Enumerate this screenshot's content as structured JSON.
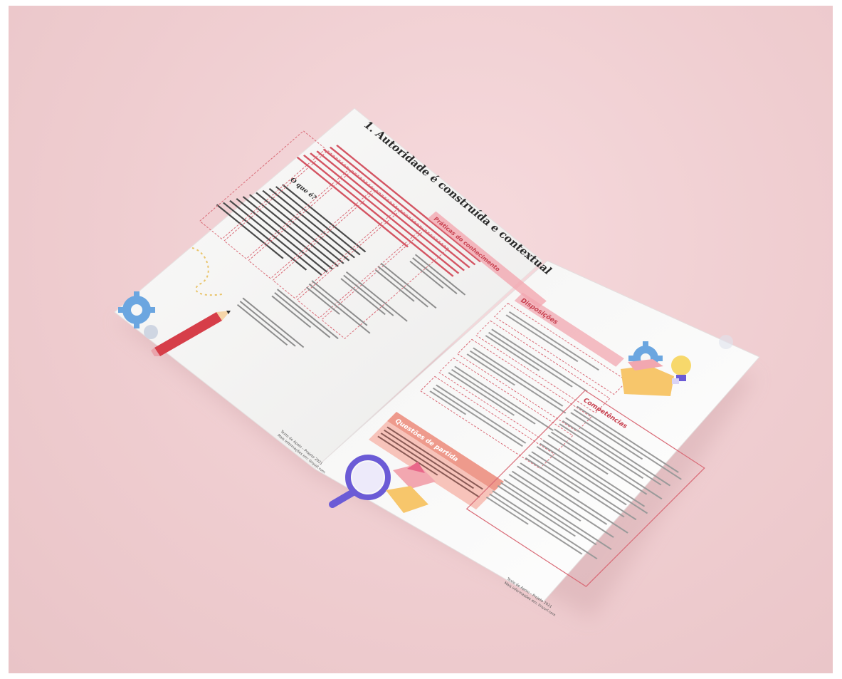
{
  "left_page": {
    "title": "1.   Autoridade é construída e contextual",
    "section_label": "O que é?",
    "knowledge_box": "Práticas do conhecimento",
    "footer_line1": "Texto de Apoio – Projeto 2021",
    "footer_line2": "Mais informações em: tinyurl.com"
  },
  "right_page": {
    "box_top_title": "Disposições",
    "box_mid_title": "Questões de partida",
    "box_right_title": "Competências",
    "footer_line1": "Texto de Apoio – Projeto 2021",
    "footer_line2": "Mais informações em: tinyurl.com"
  },
  "colors": {
    "background": "#efcdd0",
    "accent_red": "#c8404f",
    "accent_pink": "#f2a7b0",
    "accent_salmon": "#ee9a8c",
    "paper": "#f7f7f6",
    "gear_blue": "#6ba6e0",
    "folder_yellow": "#f7c66b",
    "magnifier_purple": "#6b5bd6"
  },
  "illustrations": [
    "gear-icon",
    "pencil-icon",
    "magnifier-icon",
    "folder-icon",
    "lightbulb-icon",
    "envelope-icon"
  ]
}
